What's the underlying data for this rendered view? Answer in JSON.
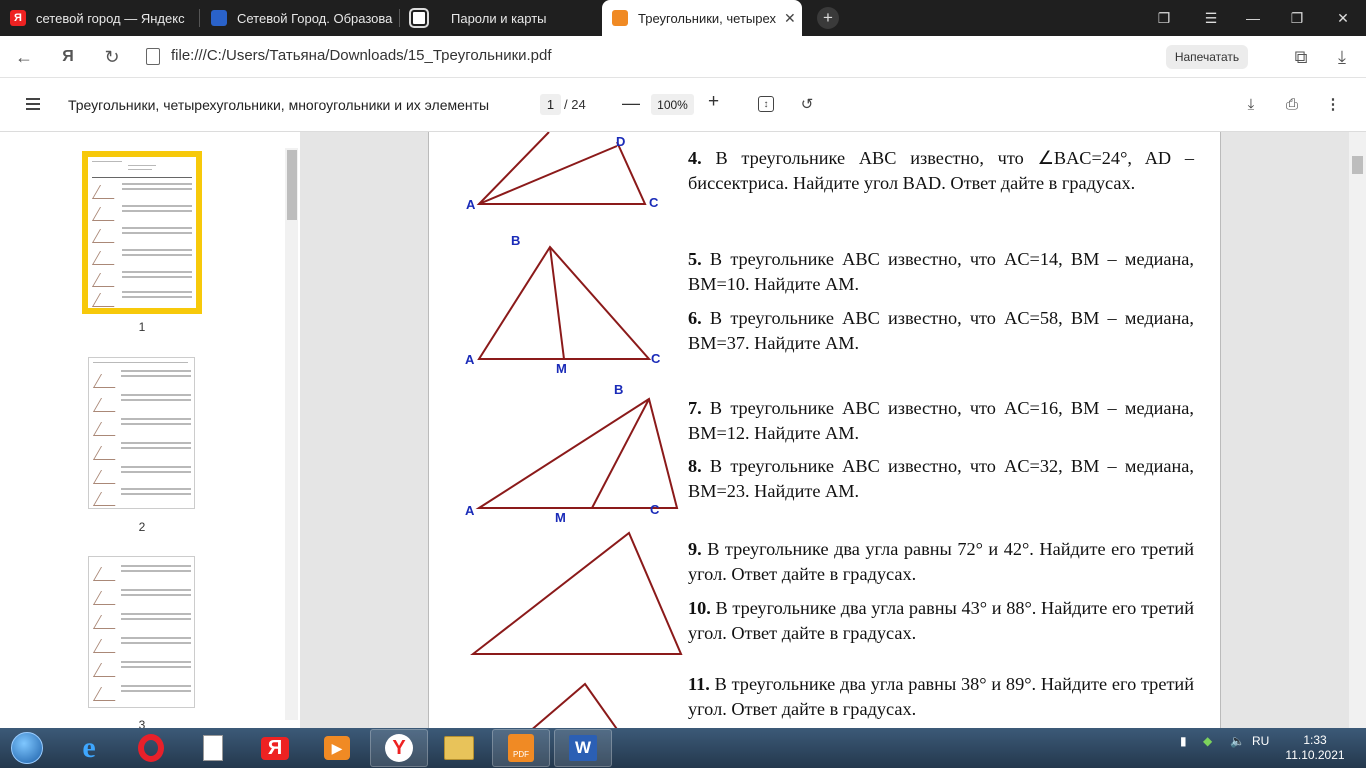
{
  "browser": {
    "tabs": [
      {
        "title": "сетевой город — Яндекс",
        "icon": "yandex-icon",
        "active": false
      },
      {
        "title": "Сетевой Город. Образова",
        "icon": "school-site-icon",
        "active": false
      },
      {
        "title": "Пароли и карты",
        "icon": "passwords-icon",
        "active": false
      },
      {
        "title": "Треугольники, четырех",
        "icon": "pdf-icon",
        "active": true
      }
    ],
    "url": "file:///C:/Users/Татьяна/Downloads/15_Треугольники.pdf",
    "print_label": "Напечатать"
  },
  "pdf_toolbar": {
    "title": "Треугольники, четырехугольники, многоугольники и их элементы",
    "current_page": "1",
    "total_pages": "/ 24",
    "zoom": "100%"
  },
  "thumbnails": [
    {
      "label": "1",
      "selected": true
    },
    {
      "label": "2",
      "selected": false
    },
    {
      "label": "3",
      "selected": false
    }
  ],
  "figures": {
    "fig1": {
      "labels": [
        "A",
        "C",
        "D"
      ]
    },
    "fig2": {
      "labels": [
        "B",
        "A",
        "M",
        "C"
      ]
    },
    "fig3": {
      "labels": [
        "B",
        "A",
        "M",
        "C"
      ]
    }
  },
  "problems": [
    {
      "num": "4.",
      "text": "В треугольнике ABC известно, что ∠BAC=24°, AD – биссектриса. Найдите угол BAD. Ответ дайте в градусах."
    },
    {
      "num": "5.",
      "text": "В треугольнике ABC известно, что AC=14, BM – медиана, BM=10. Найдите AM."
    },
    {
      "num": "6.",
      "text": "В треугольнике ABC известно, что AC=58, BM – медиана, BM=37. Найдите AM."
    },
    {
      "num": "7.",
      "text": "В треугольнике ABC известно, что AC=16, BM – медиана, BM=12. Найдите AM."
    },
    {
      "num": "8.",
      "text": "В треугольнике ABC известно, что AC=32, BM – медиана, BM=23. Найдите AM."
    },
    {
      "num": "9.",
      "text": "В треугольнике два угла равны 72° и 42°. Найдите его третий угол. Ответ дайте в градусах."
    },
    {
      "num": "10.",
      "text": "В треугольнике два угла равны 43° и 88°. Найдите его третий угол. Ответ дайте в градусах."
    },
    {
      "num": "11.",
      "text": "В треугольнике два угла равны 38° и 89°. Найдите его третий угол. Ответ дайте в градусах."
    }
  ],
  "taskbar": {
    "apps": [
      "start-orb",
      "internet-explorer",
      "opera",
      "blank-document",
      "yandex",
      "media-player",
      "yandex-browser",
      "file-explorer",
      "pdf-reader",
      "word"
    ],
    "lang": "RU",
    "time": "1:33",
    "date": "11.10.2021"
  },
  "colors": {
    "figure_stroke": "#8b1a1a",
    "figure_label": "#1a2bb8",
    "thumb_highlight": "#f7c90a"
  }
}
